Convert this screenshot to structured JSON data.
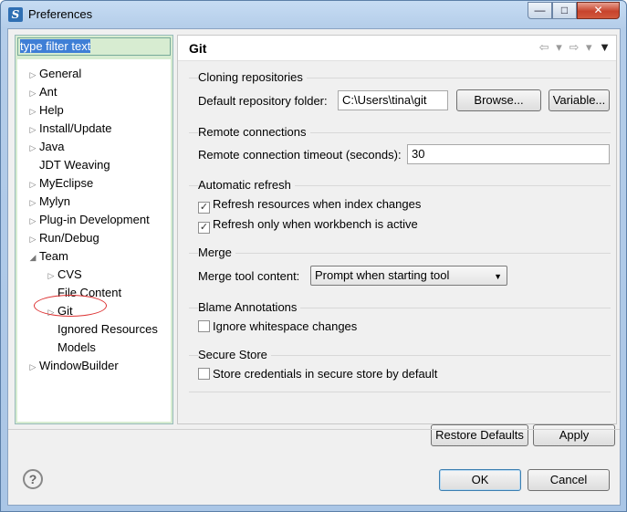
{
  "window": {
    "title": "Preferences",
    "app_icon": "eclipse-icon",
    "controls": {
      "minimize": "—",
      "maximize": "□",
      "close": "✕"
    }
  },
  "filter": {
    "placeholder": "type filter text",
    "value": "type filter text"
  },
  "tree": [
    {
      "label": "General",
      "arrow": "▷"
    },
    {
      "label": "Ant",
      "arrow": "▷"
    },
    {
      "label": "Help",
      "arrow": "▷"
    },
    {
      "label": "Install/Update",
      "arrow": "▷"
    },
    {
      "label": "Java",
      "arrow": "▷"
    },
    {
      "label": "JDT Weaving",
      "arrow": ""
    },
    {
      "label": "MyEclipse",
      "arrow": "▷"
    },
    {
      "label": "Mylyn",
      "arrow": "▷"
    },
    {
      "label": "Plug-in Development",
      "arrow": "▷"
    },
    {
      "label": "Run/Debug",
      "arrow": "▷"
    },
    {
      "label": "Team",
      "arrow": "◢"
    },
    {
      "label": "CVS",
      "arrow": "▷"
    },
    {
      "label": "File Content",
      "arrow": ""
    },
    {
      "label": "Git",
      "arrow": "▷"
    },
    {
      "label": "Ignored Resources",
      "arrow": ""
    },
    {
      "label": "Models",
      "arrow": ""
    },
    {
      "label": "WindowBuilder",
      "arrow": "▷"
    }
  ],
  "page": {
    "title": "Git",
    "nav": {
      "back": "⇦",
      "dropdown": "▾",
      "forward": "⇨",
      "menu": "▼"
    },
    "cloning": {
      "title": "Cloning repositories",
      "folder_label": "Default repository folder:",
      "folder_value": "C:\\Users\\tina\\git",
      "browse": "Browse...",
      "variable": "Variable..."
    },
    "remote": {
      "title": "Remote connections",
      "timeout_label": "Remote connection timeout (seconds):",
      "timeout_value": "30"
    },
    "refresh": {
      "title": "Automatic refresh",
      "opt1": "Refresh resources when index changes",
      "opt1_checked": true,
      "opt2": "Refresh only when workbench is active",
      "opt2_checked": true
    },
    "merge": {
      "title": "Merge",
      "tool_label": "Merge tool content:",
      "tool_value": "Prompt when starting tool"
    },
    "blame": {
      "title": "Blame Annotations",
      "opt1": "Ignore whitespace changes",
      "opt1_checked": false
    },
    "secure": {
      "title": "Secure Store",
      "opt1": "Store credentials in secure store by default",
      "opt1_checked": false
    },
    "restore_defaults": "Restore Defaults",
    "apply": "Apply"
  },
  "footer": {
    "help": "?",
    "ok": "OK",
    "cancel": "Cancel"
  }
}
